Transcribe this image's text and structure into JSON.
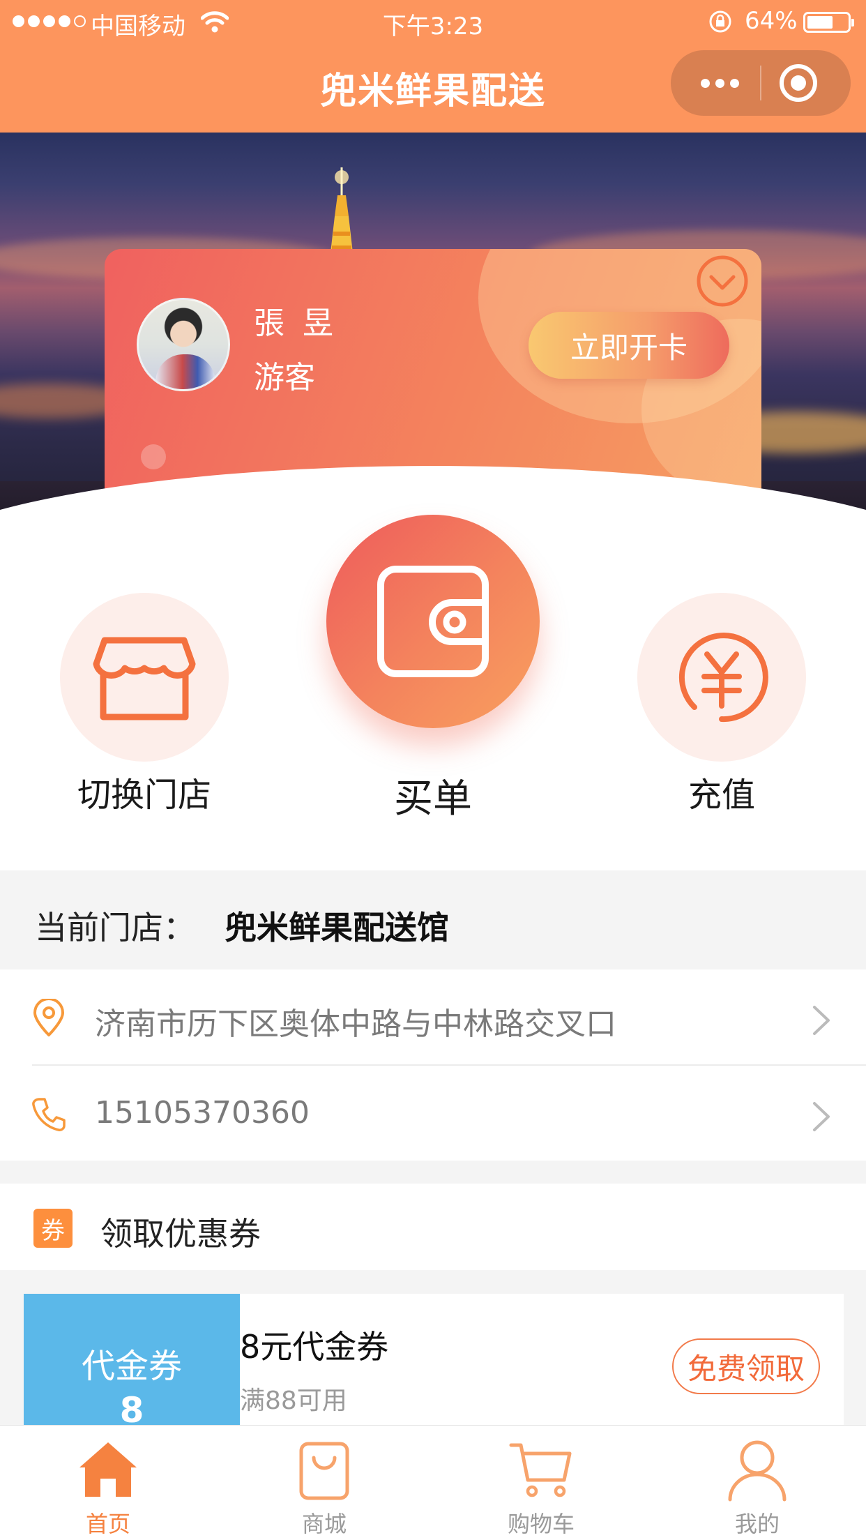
{
  "status_bar": {
    "carrier": "中国移动",
    "time": "下午3:23",
    "battery": "64%"
  },
  "nav": {
    "title": "兜米鲜果配送"
  },
  "member_card": {
    "name": "張 昱",
    "level": "游客",
    "open_card_label": "立即开卡"
  },
  "actions": {
    "switch_store": "切换门店",
    "pay": "买单",
    "recharge": "充值"
  },
  "store": {
    "current_label": "当前门店：",
    "name": "兜米鲜果配送馆",
    "address": "济南市历下区奥体中路与中林路交叉口",
    "phone": "15105370360"
  },
  "coupons": {
    "badge": "券",
    "section_title": "领取优惠券",
    "items": [
      {
        "type": "代金券",
        "amount": "8",
        "name": "8元代金券",
        "condition": "满88可用",
        "claim_label": "免费领取"
      }
    ]
  },
  "tabbar": {
    "active": "home",
    "items": [
      {
        "key": "home",
        "label": "首页"
      },
      {
        "key": "mall",
        "label": "商城"
      },
      {
        "key": "cart",
        "label": "购物车"
      },
      {
        "key": "mine",
        "label": "我的"
      }
    ]
  },
  "colors": {
    "brand": "#fd955d",
    "accent": "#f58240",
    "coupon_stub": "#5bb8e9"
  }
}
